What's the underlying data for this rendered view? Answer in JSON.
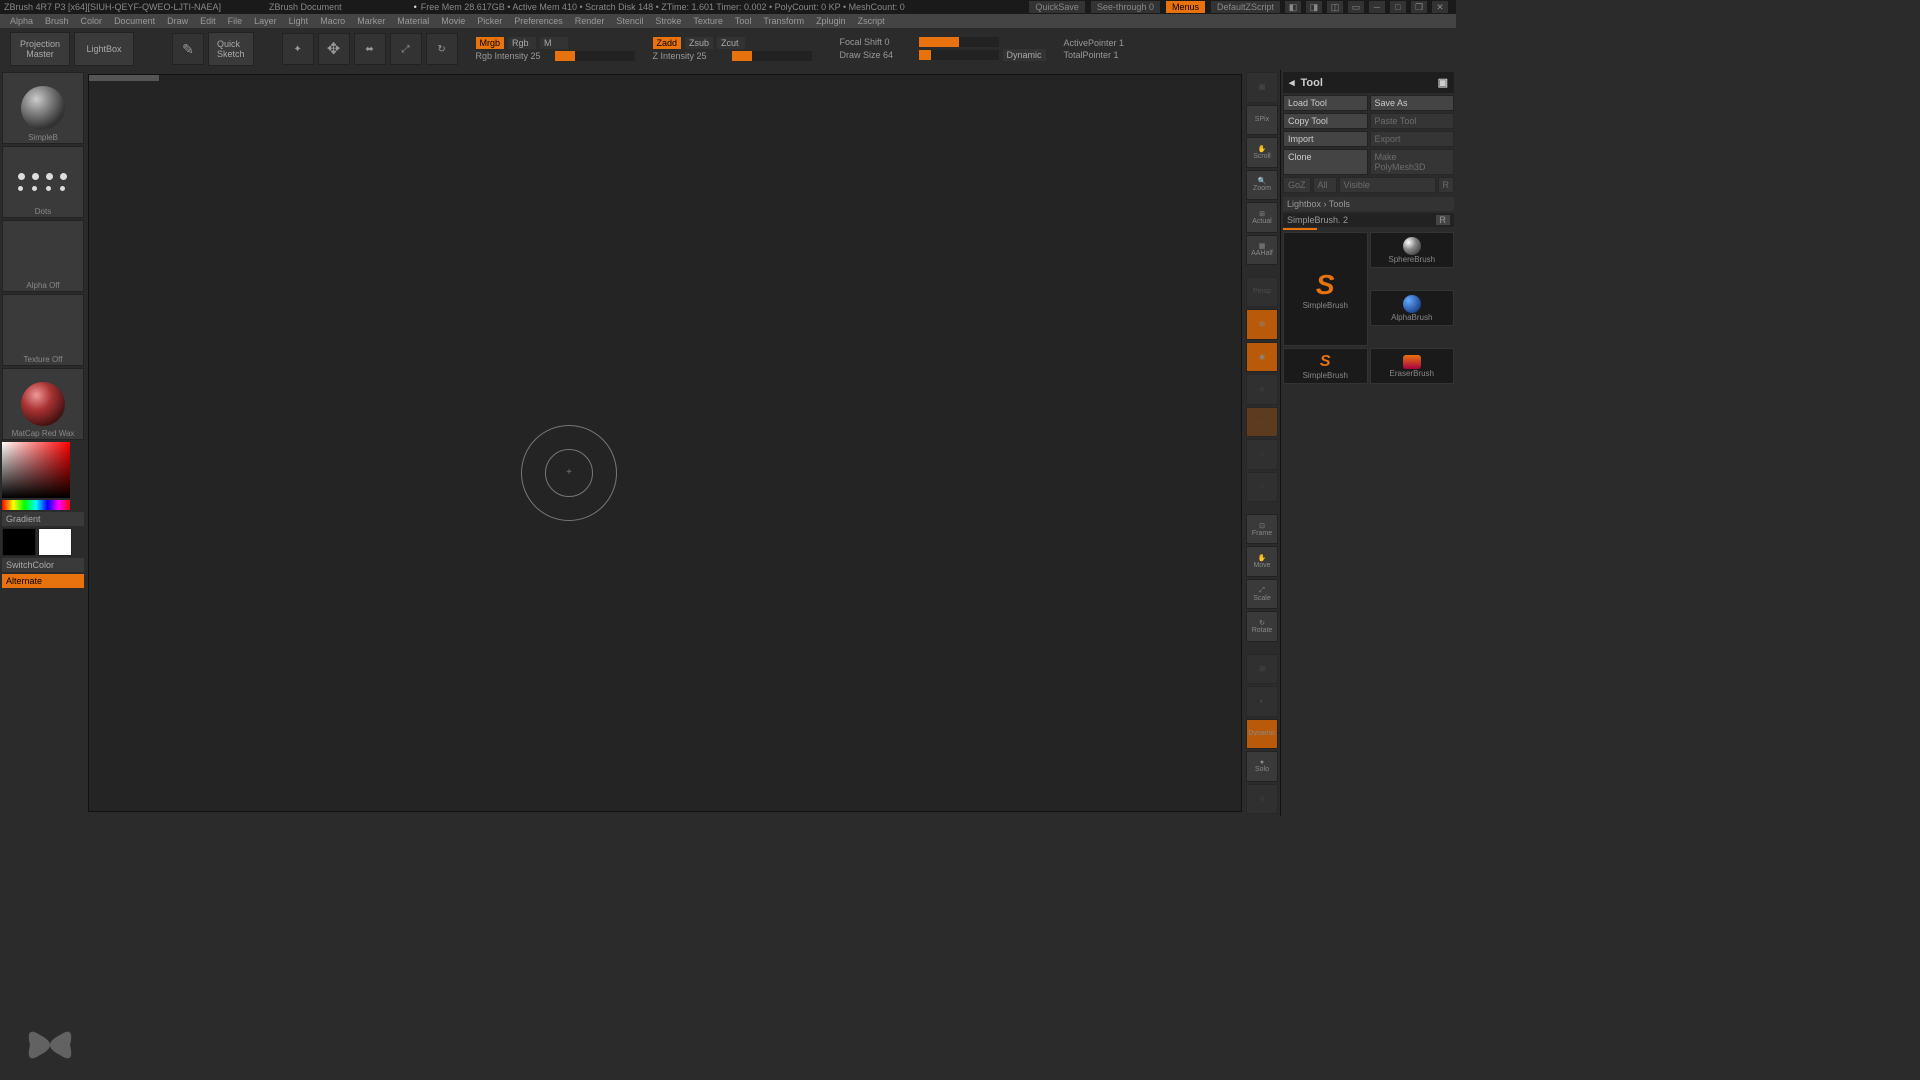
{
  "titlebar": {
    "app": "ZBrush 4R7 P3 [x64][SIUH-QEYF-QWEO-LJTI-NAEA]",
    "doc": "ZBrush Document",
    "stats": "Free Mem 28.617GB • Active Mem 410 • Scratch Disk 148 • ZTime: 1.601 Timer: 0.002 • PolyCount: 0 KP • MeshCount: 0",
    "quicksave": "QuickSave",
    "seethrough": "See-through  0",
    "menus": "Menus",
    "script": "DefaultZScript"
  },
  "menus": [
    "Alpha",
    "Brush",
    "Color",
    "Document",
    "Draw",
    "Edit",
    "File",
    "Layer",
    "Light",
    "Macro",
    "Marker",
    "Material",
    "Movie",
    "Picker",
    "Preferences",
    "Render",
    "Stencil",
    "Stroke",
    "Texture",
    "Tool",
    "Transform",
    "Zplugin",
    "Zscript"
  ],
  "shelf": {
    "projection": "Projection\nMaster",
    "lightbox": "LightBox",
    "quicksketch": "Quick\nSketch",
    "draw": "Draw",
    "move": "Move",
    "scale": "Scale",
    "rotate": "Rotate",
    "mrgb": "Mrgb",
    "rgb": "Rgb",
    "m": "M",
    "rgb_intensity": "Rgb Intensity 25",
    "zadd": "Zadd",
    "zsub": "Zsub",
    "zcut": "Zcut",
    "z_intensity": "Z Intensity 25",
    "focal_shift": "Focal Shift 0",
    "draw_size": "Draw Size 64",
    "dynamic": "Dynamic",
    "active_pointer": "ActivePointer 1",
    "total_pointer": "TotalPointer 1"
  },
  "left": {
    "brush_label": "SimpleB",
    "stroke_label": "Dots",
    "alpha_label": "Alpha Off",
    "texture_label": "Texture Off",
    "material_label": "MatCap Red Wax",
    "gradient": "Gradient",
    "switchcolor": "SwitchColor",
    "alternate": "Alternate"
  },
  "right_tb": {
    "spix": "SPix",
    "scroll": "Scroll",
    "zoom": "Zoom",
    "actual": "Actual",
    "aahalf": "AAHalf",
    "persp": "Persp",
    "frame": "Frame",
    "move": "Move",
    "scale": "Scale",
    "rotate": "Rotate",
    "solo": "Solo",
    "dynamic": "Dynamic"
  },
  "tool": {
    "header": "Tool",
    "load": "Load Tool",
    "save": "Save As",
    "copy": "Copy Tool",
    "paste": "Paste Tool",
    "import": "Import",
    "export": "Export",
    "clone": "Clone",
    "polymesh": "Make PolyMesh3D",
    "gizmo_labels": [
      "GoZ",
      "All",
      "Visible",
      "R"
    ],
    "lightbox_tools": "Lightbox › Tools",
    "current": "SimpleBrush. 2",
    "r": "R",
    "items": [
      {
        "name": "SimpleBrush"
      },
      {
        "name": "SphereBrush"
      },
      {
        "name": "SimpleBrush"
      },
      {
        "name": "AlphaBrush"
      },
      {
        "name": ""
      },
      {
        "name": "EraserBrush"
      }
    ]
  }
}
